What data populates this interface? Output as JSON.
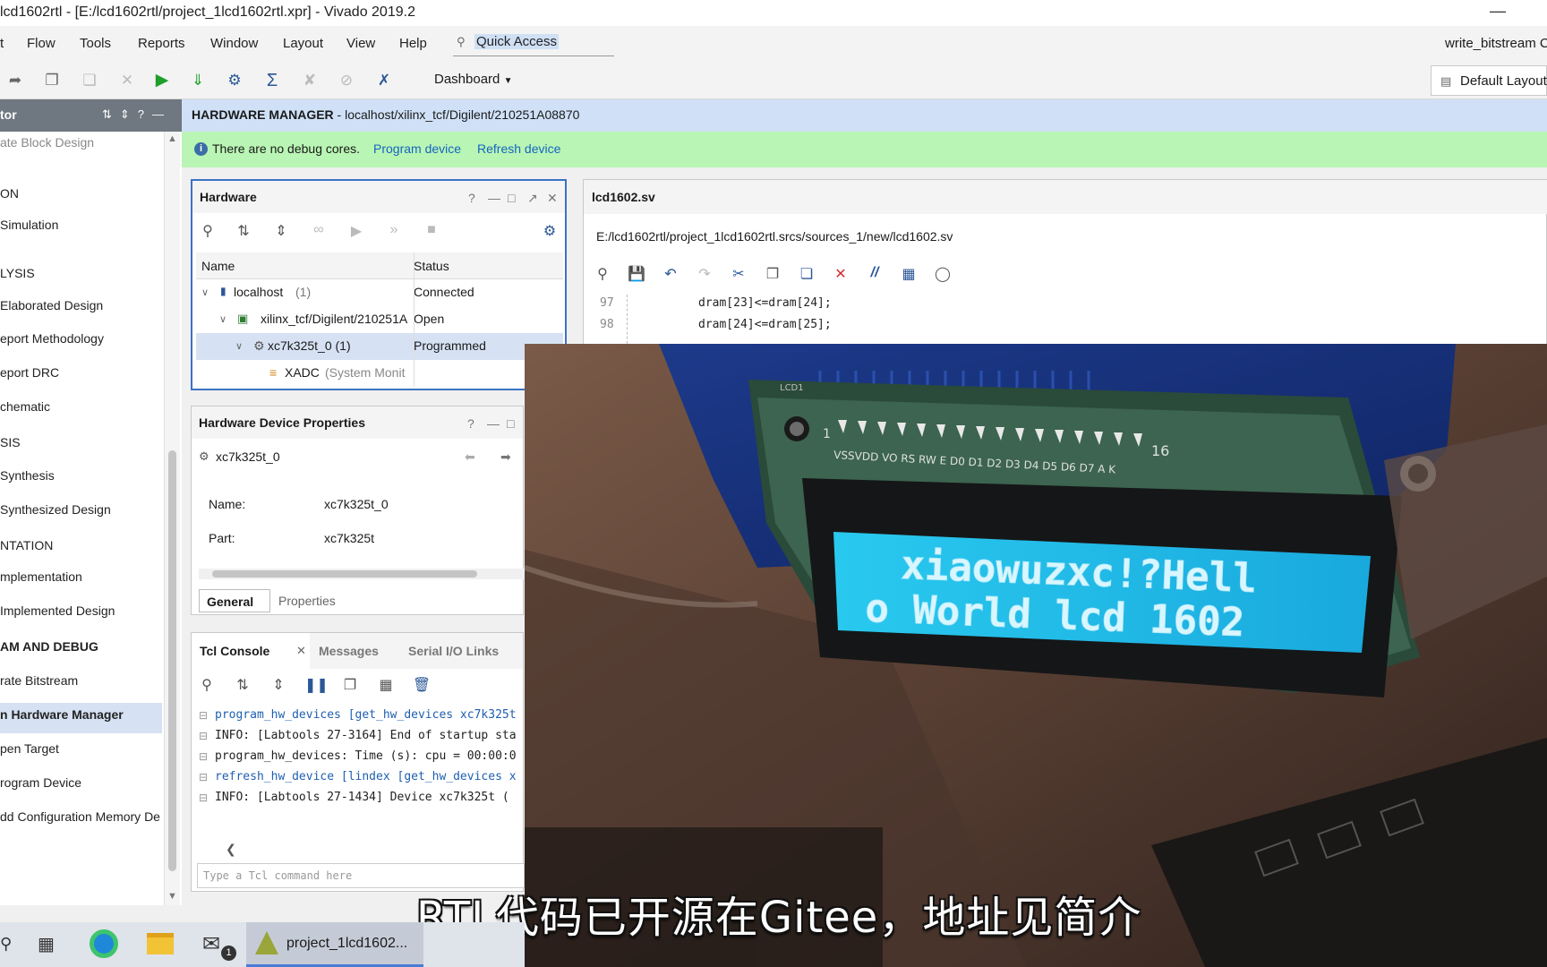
{
  "window": {
    "title": "lcd1602rtl - [E:/lcd1602rtl/project_1lcd1602rtl.xpr] - Vivado 2019.2",
    "minimize_symbol": "—"
  },
  "menu": {
    "items": [
      "Flow",
      "Tools",
      "Reports",
      "Window",
      "Layout",
      "View",
      "Help"
    ],
    "quick_access": "Quick Access",
    "status_right": "write_bitstream C"
  },
  "toolbar": {
    "dashboard_label": "Dashboard",
    "layout_label": "Default Layout"
  },
  "flow_navigator": {
    "header": "tor",
    "items": [
      {
        "label": "ate Block Design",
        "style": "grey"
      },
      {
        "label": "ON",
        "style": "section"
      },
      {
        "label": "Simulation",
        "style": ""
      },
      {
        "label": "LYSIS",
        "style": "section"
      },
      {
        "label": " Elaborated Design",
        "style": ""
      },
      {
        "label": "eport Methodology",
        "style": ""
      },
      {
        "label": "eport DRC",
        "style": ""
      },
      {
        "label": "chematic",
        "style": ""
      },
      {
        "label": "SIS",
        "style": "section"
      },
      {
        "label": "Synthesis",
        "style": ""
      },
      {
        "label": " Synthesized Design",
        "style": ""
      },
      {
        "label": "NTATION",
        "style": "section"
      },
      {
        "label": "mplementation",
        "style": ""
      },
      {
        "label": " Implemented Design",
        "style": ""
      },
      {
        "label": "AM AND DEBUG",
        "style": "bold"
      },
      {
        "label": "rate Bitstream",
        "style": ""
      },
      {
        "label": "n Hardware Manager",
        "style": "bold"
      },
      {
        "label": "pen Target",
        "style": ""
      },
      {
        "label": "rogram Device",
        "style": ""
      },
      {
        "label": "dd Configuration Memory De",
        "style": ""
      }
    ]
  },
  "hardware_manager": {
    "title_bold": "HARDWARE MANAGER",
    "title_rest": " - localhost/xilinx_tcf/Digilent/210251A08870",
    "info_message": "There are no debug cores.",
    "link_program": "Program device",
    "link_refresh": "Refresh device"
  },
  "hardware_panel": {
    "title": "Hardware",
    "columns": [
      "Name",
      "Status"
    ],
    "rows": [
      {
        "name": "localhost",
        "count": "(1)",
        "status": "Connected"
      },
      {
        "name": "xilinx_tcf/Digilent/210251A",
        "count": "",
        "status": "Open"
      },
      {
        "name": "xc7k325t_0 (1)",
        "count": "",
        "status": "Programmed"
      },
      {
        "name": "XADC",
        "count": "(System Monit",
        "status": ""
      }
    ]
  },
  "device_properties": {
    "title": "Hardware Device Properties",
    "device": "xc7k325t_0",
    "fields": [
      {
        "label": "Name:",
        "value": "xc7k325t_0"
      },
      {
        "label": "Part:",
        "value": "xc7k325t"
      }
    ],
    "tabs": [
      "General",
      "Properties"
    ]
  },
  "tcl_console": {
    "tabs": [
      "Tcl Console",
      "Messages",
      "Serial I/O Links"
    ],
    "lines": [
      {
        "text": "program_hw_devices [get_hw_devices xc7k325t",
        "cmd": true
      },
      {
        "text": "INFO: [Labtools 27-3164] End of startup sta",
        "cmd": false
      },
      {
        "text": "program_hw_devices: Time (s): cpu = 00:00:0",
        "cmd": false
      },
      {
        "text": "refresh_hw_device [lindex [get_hw_devices x",
        "cmd": true
      },
      {
        "text": "INFO: [Labtools 27-1434] Device xc7k325t (",
        "cmd": false
      }
    ],
    "input_placeholder": "Type a Tcl command here"
  },
  "editor": {
    "tab": "lcd1602.sv",
    "path": "E:/lcd1602rtl/project_1lcd1602rtl.srcs/sources_1/new/lcd1602.sv",
    "lines": [
      {
        "num": "97",
        "code": "dram[23]<=dram[24];"
      },
      {
        "num": "98",
        "code": "dram[24]<=dram[25];"
      }
    ]
  },
  "video": {
    "lcd_line1": "xiaowuzxc!?Hell",
    "lcd_line2": "o World lcd 1602",
    "pin_labels": "VSSVDD VO RS RW E  D0 D1 D2 D3 D4 D5 D6 D7 A  K",
    "pin_first": "1",
    "pin_last": "16",
    "silk": "LCD1"
  },
  "subtitle": "RTL代码已开源在Gitee，地址见简介",
  "taskbar": {
    "app_label": "project_1lcd1602...",
    "badge": "1"
  }
}
